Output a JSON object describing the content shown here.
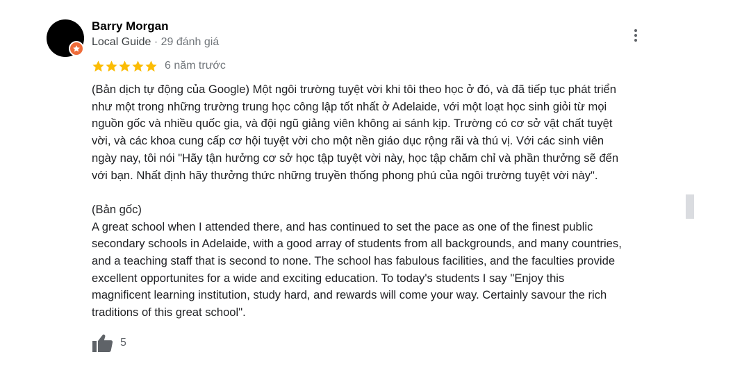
{
  "review": {
    "author": {
      "name": "Barry Morgan",
      "badge_icon": "local-guide-star-icon",
      "badge_color": "#ef6c3a",
      "level": "Local Guide",
      "separator": " · ",
      "review_count": "29 đánh giá"
    },
    "menu_icon": "more-vert-icon",
    "rating": 5,
    "rating_max": 5,
    "star_color": "#fbbc04",
    "time_ago": "6 năm trước",
    "translation_paragraph": "(Bản dịch tự động của Google) Một ngôi trường tuyệt vời khi tôi theo học ở đó, và đã tiếp tục phát triển\nnhư một trong những trường trung học công lập tốt nhất ở Adelaide, với một loạt học sinh giỏi từ mọi\nnguồn gốc và nhiều quốc gia, và đội ngũ giảng viên không ai sánh kịp. Trường có cơ sở vật chất tuyệt\nvời, và các khoa cung cấp cơ hội tuyệt vời cho một nền giáo dục rộng rãi và thú vị. Với các sinh viên\nngày nay, tôi nói \"Hãy tận hưởng cơ sở học tập tuyệt vời này, học tập chăm chỉ và phần thưởng sẽ đến\nvới bạn. Nhất định hãy thưởng thức những truyền thống phong phú của ngôi trường tuyệt vời này\".",
    "original_heading": "(Bản gốc)",
    "original_paragraph": "A great school when I attended there, and has continued to set the pace as one of the finest public\nsecondary schools in Adelaide, with a good array of students from all backgrounds, and many countries,\nand a teaching staff that is second to none.  The school has fabulous facilities, and the faculties provide\nexcellent opportunites for a wide and exciting education.  To today's students I say \"Enjoy this\nmagnificent learning institution, study hard, and rewards will come your way.  Certainly savour the rich\ntraditions of this great school\".",
    "like_icon": "thumbs-up-icon",
    "like_count": "5"
  }
}
